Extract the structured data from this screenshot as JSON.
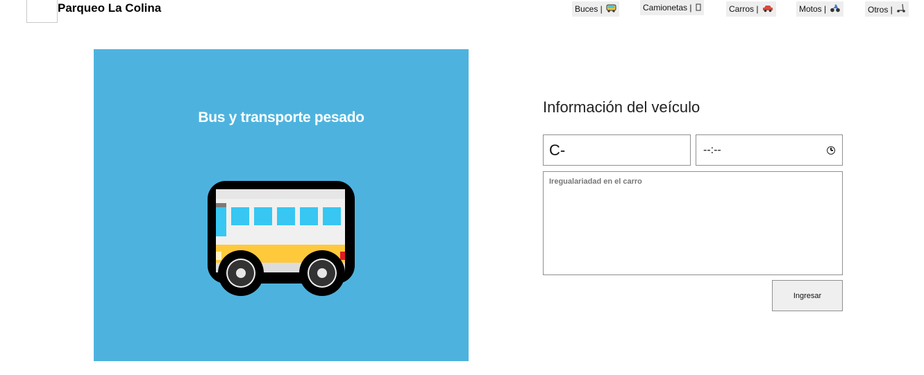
{
  "header": {
    "brand": "Parqueo La Colina"
  },
  "nav": [
    {
      "label": "Buces |",
      "icon": "bus-icon"
    },
    {
      "label": "Camionetas |",
      "icon": "van-icon"
    },
    {
      "label": "Carros |",
      "icon": "car-icon"
    },
    {
      "label": "Motos |",
      "icon": "motorcycle-icon"
    },
    {
      "label": "Otros |",
      "icon": "scooter-icon"
    }
  ],
  "panel": {
    "title": "Bus y transporte pesado",
    "background": "#4db3de",
    "illustration": "bus-illustration"
  },
  "form": {
    "title": "Información del veículo",
    "plate_value": "C-",
    "time_placeholder": "--:--",
    "notes_placeholder": "Iregualariadad en el carro",
    "submit_label": "Ingresar"
  }
}
